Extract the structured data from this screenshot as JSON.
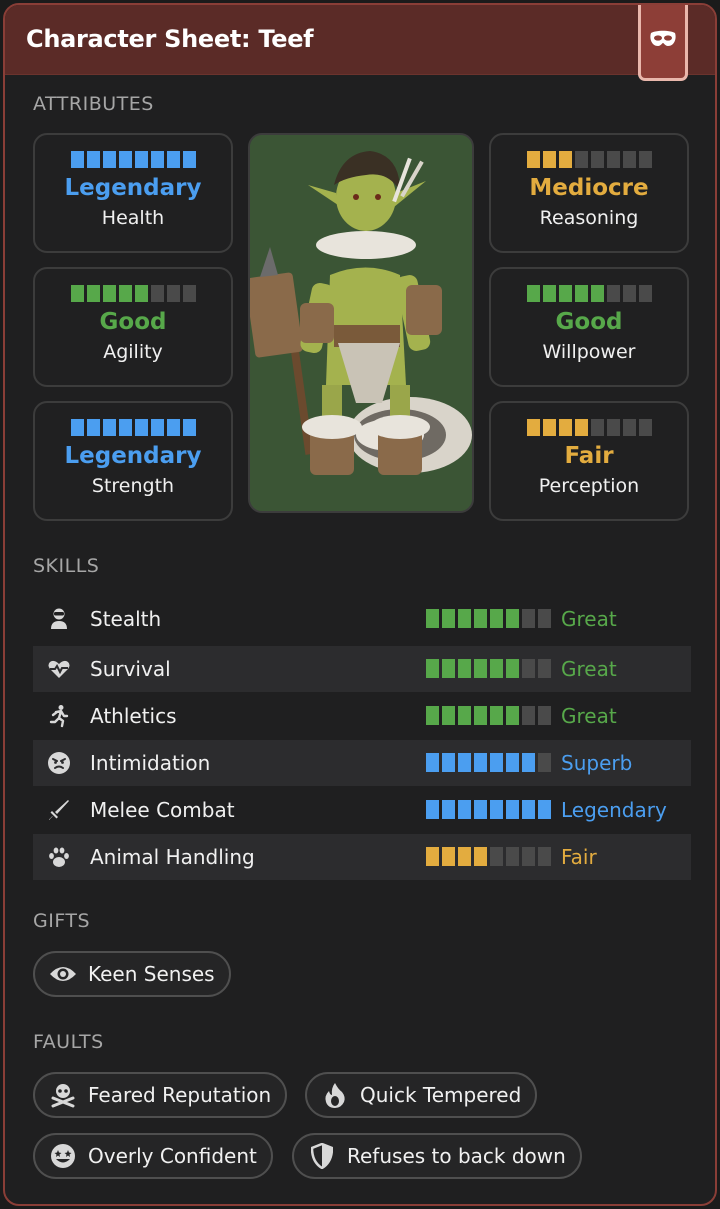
{
  "header": {
    "title": "Character Sheet: Teef",
    "badge_icon": "mask-icon"
  },
  "colors": {
    "legendary": "#4b9ef0",
    "superb": "#4b9ef0",
    "great": "#57a84a",
    "good": "#57a84a",
    "fair": "#e3ac3f",
    "mediocre": "#e3ac3f",
    "empty_pip": "#4a4a4a"
  },
  "attributes": {
    "label": "ATTRIBUTES",
    "items": [
      {
        "name": "Health",
        "rating": "Legendary",
        "filled": 8,
        "total": 8,
        "color": "#4b9ef0"
      },
      {
        "name": "Agility",
        "rating": "Good",
        "filled": 5,
        "total": 8,
        "color": "#57a84a"
      },
      {
        "name": "Strength",
        "rating": "Legendary",
        "filled": 8,
        "total": 8,
        "color": "#4b9ef0"
      },
      {
        "name": "Reasoning",
        "rating": "Mediocre",
        "filled": 3,
        "total": 8,
        "color": "#e3ac3f"
      },
      {
        "name": "Willpower",
        "rating": "Good",
        "filled": 5,
        "total": 8,
        "color": "#57a84a"
      },
      {
        "name": "Perception",
        "rating": "Fair",
        "filled": 4,
        "total": 8,
        "color": "#e3ac3f"
      }
    ]
  },
  "portrait": {
    "icon": "goblin-portrait"
  },
  "skills": {
    "label": "SKILLS",
    "items": [
      {
        "name": "Stealth",
        "icon": "ninja-icon",
        "rating": "Great",
        "filled": 6,
        "total": 8,
        "color": "#57a84a"
      },
      {
        "name": "Survival",
        "icon": "heartbeat-icon",
        "rating": "Great",
        "filled": 6,
        "total": 8,
        "color": "#57a84a"
      },
      {
        "name": "Athletics",
        "icon": "running-icon",
        "rating": "Great",
        "filled": 6,
        "total": 8,
        "color": "#57a84a"
      },
      {
        "name": "Intimidation",
        "icon": "angry-face-icon",
        "rating": "Superb",
        "filled": 7,
        "total": 8,
        "color": "#4b9ef0"
      },
      {
        "name": "Melee Combat",
        "icon": "sword-icon",
        "rating": "Legendary",
        "filled": 8,
        "total": 8,
        "color": "#4b9ef0"
      },
      {
        "name": "Animal Handling",
        "icon": "paw-icon",
        "rating": "Fair",
        "filled": 4,
        "total": 8,
        "color": "#e3ac3f"
      }
    ]
  },
  "gifts": {
    "label": "GIFTS",
    "items": [
      {
        "label": "Keen Senses",
        "icon": "eye-icon"
      }
    ]
  },
  "faults": {
    "label": "FAULTS",
    "items": [
      {
        "label": "Feared Reputation",
        "icon": "skull-crossbones-icon"
      },
      {
        "label": "Quick Tempered",
        "icon": "fire-icon"
      },
      {
        "label": "Overly Confident",
        "icon": "grin-stars-icon"
      },
      {
        "label": "Refuses to back down",
        "icon": "shield-icon"
      }
    ]
  }
}
